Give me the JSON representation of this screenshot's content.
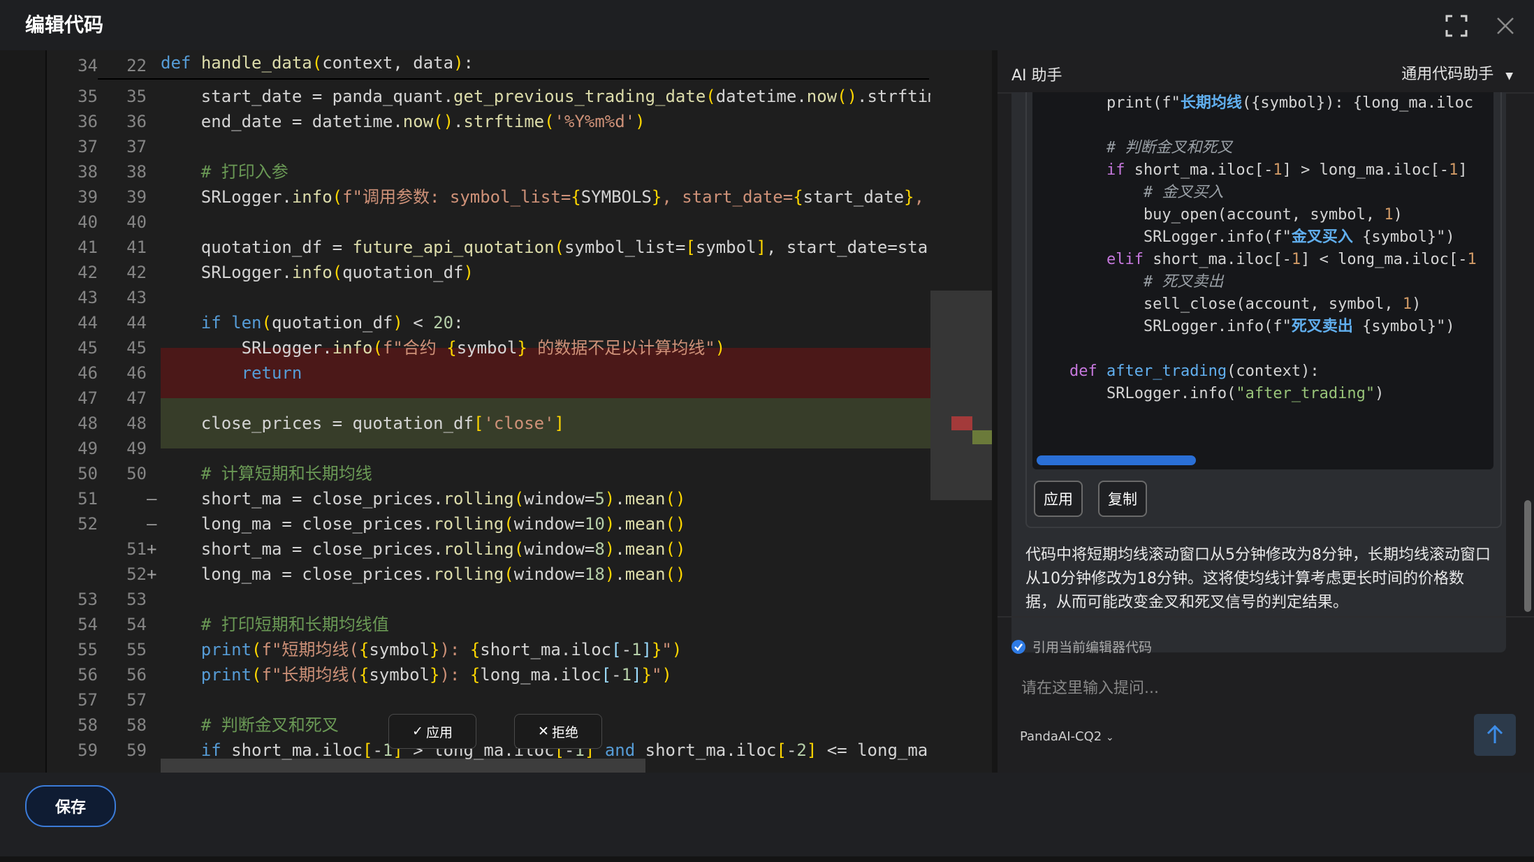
{
  "window": {
    "title": "编辑代码"
  },
  "editor": {
    "sticky": {
      "left": "34",
      "right": "22"
    },
    "lines": [
      {
        "l": "35",
        "r": "35",
        "type": "ctx"
      },
      {
        "l": "36",
        "r": "36",
        "type": "ctx"
      },
      {
        "l": "37",
        "r": "37",
        "type": "ctx"
      },
      {
        "l": "38",
        "r": "38",
        "type": "ctx"
      },
      {
        "l": "39",
        "r": "39",
        "type": "ctx"
      },
      {
        "l": "40",
        "r": "40",
        "type": "ctx"
      },
      {
        "l": "41",
        "r": "41",
        "type": "ctx"
      },
      {
        "l": "42",
        "r": "42",
        "type": "ctx"
      },
      {
        "l": "43",
        "r": "43",
        "type": "ctx"
      },
      {
        "l": "44",
        "r": "44",
        "type": "ctx"
      },
      {
        "l": "45",
        "r": "45",
        "type": "ctx"
      },
      {
        "l": "46",
        "r": "46",
        "type": "ctx"
      },
      {
        "l": "47",
        "r": "47",
        "type": "ctx"
      },
      {
        "l": "48",
        "r": "48",
        "type": "ctx"
      },
      {
        "l": "49",
        "r": "49",
        "type": "ctx"
      },
      {
        "l": "50",
        "r": "50",
        "type": "ctx"
      },
      {
        "l": "51",
        "r": "",
        "mark": "—",
        "type": "del"
      },
      {
        "l": "52",
        "r": "",
        "mark": "—",
        "type": "del"
      },
      {
        "l": "",
        "r": "51",
        "mark": "+",
        "type": "add"
      },
      {
        "l": "",
        "r": "52",
        "mark": "+",
        "type": "add"
      },
      {
        "l": "53",
        "r": "53",
        "type": "ctx"
      },
      {
        "l": "54",
        "r": "54",
        "type": "ctx"
      },
      {
        "l": "55",
        "r": "55",
        "type": "ctx"
      },
      {
        "l": "56",
        "r": "56",
        "type": "ctx"
      },
      {
        "l": "57",
        "r": "57",
        "type": "ctx"
      },
      {
        "l": "58",
        "r": "58",
        "type": "ctx"
      },
      {
        "l": "59",
        "r": "59",
        "type": "ctx"
      }
    ],
    "apply_label": "应用",
    "reject_label": "拒绝"
  },
  "ai": {
    "title": "AI 助手",
    "mode": "通用代码助手",
    "apply_label": "应用",
    "copy_label": "复制",
    "explanation": "代码中将短期均线滚动窗口从5分钟修改为8分钟，长期均线滚动窗口从10分钟修改为18分钟。这将使均线计算考虑更长时间的价格数据，从而可能改变金叉和死叉信号的判定结果。",
    "ref_label": "引用当前编辑器代码",
    "prompt_placeholder": "请在这里输入提问...",
    "model": "PandaAI-CQ2"
  },
  "footer": {
    "save_label": "保存"
  },
  "colors": {
    "accent": "#2f7be5",
    "deleted_bg": "#4b1818",
    "added_bg": "#373d29"
  }
}
